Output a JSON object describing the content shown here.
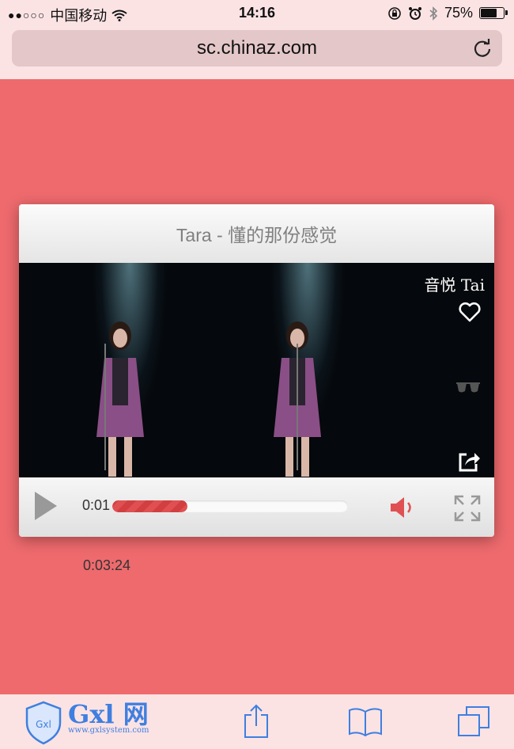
{
  "status_bar": {
    "signal": "●●○○○",
    "carrier": "中国移动",
    "time": "14:16",
    "battery": "75%",
    "battery_level": 0.75
  },
  "browser": {
    "url": "sc.chinaz.com"
  },
  "player": {
    "title": "Tara - 懂的那份感觉",
    "watermark": "音悦 Tai",
    "current_time": "0:01",
    "progress": 0.32,
    "duration": "0:03:24",
    "accent_color": "#e05052"
  },
  "footer_logo": {
    "name": "Gxl 网",
    "badge": "Gxl",
    "url": "www.gxlsystem.com"
  },
  "colors": {
    "page_background": "#ee6a6d",
    "chrome_background": "#fbe3e4",
    "icon_blue": "#3f7fe0"
  }
}
